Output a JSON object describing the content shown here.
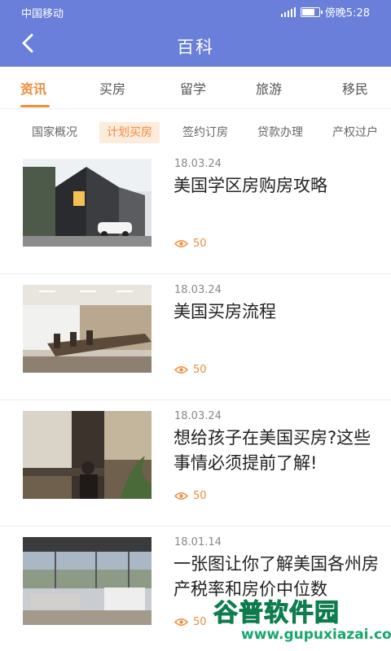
{
  "status_bar": {
    "carrier": "中国移动",
    "time": "傍晚5:28",
    "battery_level": 0.8
  },
  "header": {
    "title": "百科",
    "back_icon": "chevron-left-icon"
  },
  "tabs": [
    {
      "label": "资讯",
      "active": true
    },
    {
      "label": "买房",
      "active": false
    },
    {
      "label": "留学",
      "active": false
    },
    {
      "label": "旅游",
      "active": false
    },
    {
      "label": "移民",
      "active": false
    }
  ],
  "subtabs": [
    {
      "label": "国家概况",
      "active": false
    },
    {
      "label": "计划买房",
      "active": true
    },
    {
      "label": "签约订房",
      "active": false
    },
    {
      "label": "贷款办理",
      "active": false
    },
    {
      "label": "产权过户",
      "active": false
    }
  ],
  "articles": [
    {
      "date": "18.03.24",
      "title": "美国学区房购房攻略",
      "views": "50",
      "image": "modern-house-photo"
    },
    {
      "date": "18.03.24",
      "title": "美国买房流程",
      "views": "50",
      "image": "conference-room-photo"
    },
    {
      "date": "18.03.24",
      "title": "想给孩子在美国买房?这些事情必须提前了解!",
      "views": "50",
      "image": "office-desk-photo"
    },
    {
      "date": "18.01.14",
      "title": "一张图让你了解美国各州房产税率和房价中位数",
      "views": "50",
      "image": "living-room-photo"
    }
  ],
  "colors": {
    "header_bg": "#6a7fd9",
    "accent": "#f08c3a"
  },
  "watermark": {
    "text": "谷普软件园",
    "url": "www.gupuxiazai.com"
  }
}
